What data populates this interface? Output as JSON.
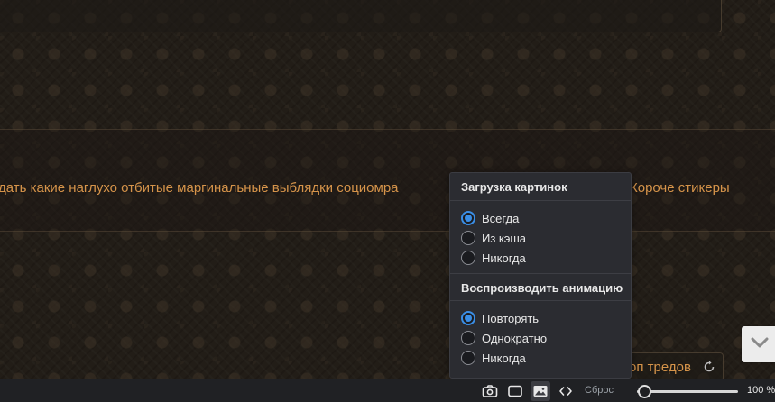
{
  "post": {
    "text_left": "дать какие наглухо отбитые маргинальные выблядки социомра",
    "text_right": "Короче стикеры"
  },
  "thread_pill": {
    "label": "оп тредов"
  },
  "popup": {
    "image_loading": {
      "title": "Загрузка картинок",
      "options": [
        {
          "label": "Всегда",
          "checked": true
        },
        {
          "label": "Из кэша",
          "checked": false
        },
        {
          "label": "Никогда",
          "checked": false
        }
      ]
    },
    "animation": {
      "title": "Воспроизводить анимацию",
      "options": [
        {
          "label": "Повторять",
          "checked": true
        },
        {
          "label": "Однократно",
          "checked": false
        },
        {
          "label": "Никогда",
          "checked": false
        }
      ]
    }
  },
  "bottom_bar": {
    "reset_label": "Сброс",
    "zoom_label": "100 %",
    "zoom_fraction": 0.07
  },
  "colors": {
    "accent": "#3a8ee6",
    "post_text": "#d6944a"
  }
}
